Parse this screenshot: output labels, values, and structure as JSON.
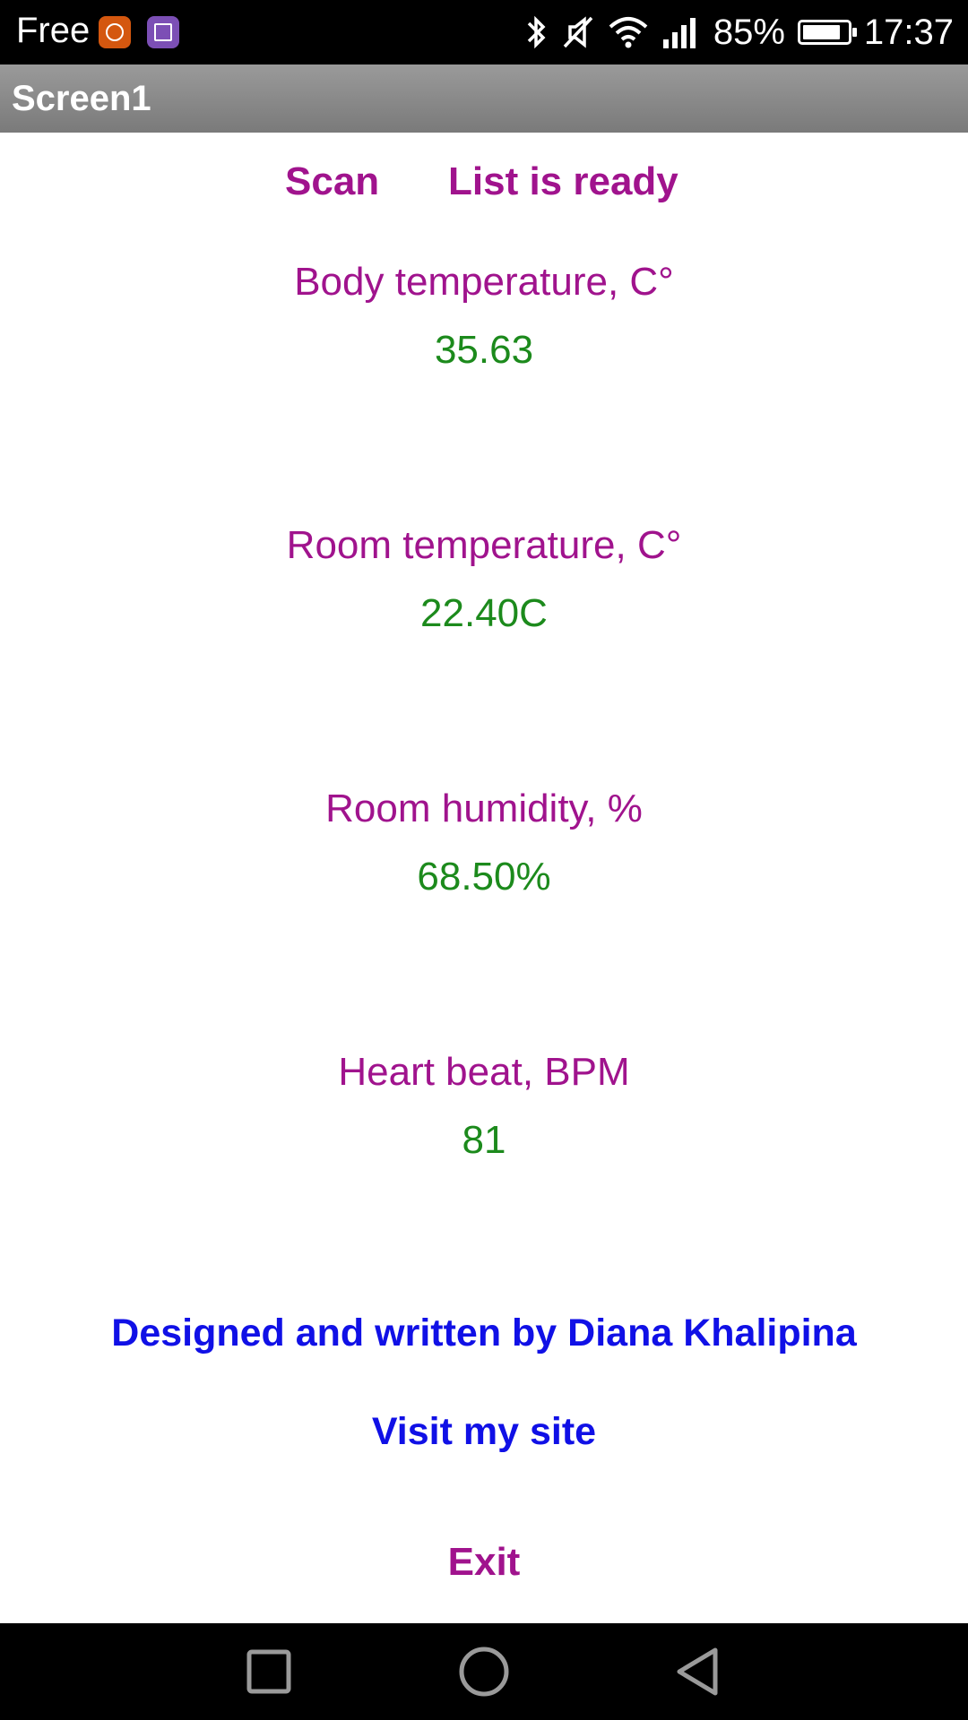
{
  "status_bar": {
    "carrier": "Free",
    "battery_percent": "85%",
    "battery_level": 0.85,
    "time": "17:37",
    "icons": [
      "mi-icon",
      "gallery-icon",
      "bluetooth-icon",
      "mute-icon",
      "wifi-icon",
      "signal-icon",
      "battery-icon"
    ]
  },
  "title_bar": {
    "title": "Screen1"
  },
  "controls": {
    "scan_label": "Scan",
    "list_status": "List is ready"
  },
  "readings": {
    "body_temp_label": "Body temperature, C°",
    "body_temp_value": "35.63",
    "room_temp_label": "Room temperature, C°",
    "room_temp_value": "22.40C",
    "humidity_label": "Room humidity, %",
    "humidity_value": "68.50%",
    "heart_label": "Heart beat, BPM",
    "heart_value": "81"
  },
  "footer": {
    "credit": "Designed and written by Diana Khalipina",
    "site_link": "Visit my site",
    "exit_label": "Exit"
  },
  "colors": {
    "label": "#a0138d",
    "value": "#1c8a1c",
    "link": "#1010e6",
    "title_bar": "#8a8a8a"
  }
}
